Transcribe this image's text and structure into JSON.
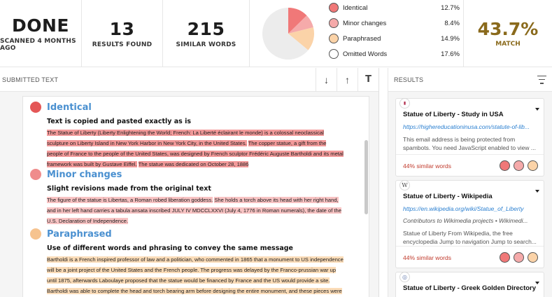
{
  "stats": {
    "status": {
      "value": "DONE",
      "label": "SCANNED 4 MONTHS AGO"
    },
    "results": {
      "value": "13",
      "label": "RESULTS FOUND"
    },
    "words": {
      "value": "215",
      "label": "SIMILAR WORDS"
    }
  },
  "pie": {
    "segments": [
      {
        "name": "Identical",
        "percent": 12.7,
        "color": "#f07878"
      },
      {
        "name": "Minor changes",
        "percent": 8.4,
        "color": "#f5aaaa"
      },
      {
        "name": "Paraphrased",
        "percent": 14.9,
        "color": "#fbd3a8"
      },
      {
        "name": "Remaining",
        "percent": 64.0,
        "color": "#ececec"
      }
    ]
  },
  "legend": [
    {
      "label": "Identical",
      "value": "12.7%",
      "color": "#f07878"
    },
    {
      "label": "Minor changes",
      "value": "8.4%",
      "color": "#f5aaaa"
    },
    {
      "label": "Paraphrased",
      "value": "14.9%",
      "color": "#fbd3a8"
    },
    {
      "label": "Omitted Words",
      "value": "17.6%",
      "color": "#ffffff"
    }
  ],
  "match": {
    "value": "43.7%",
    "label": "MATCH"
  },
  "submitted": {
    "title": "SUBMITTED TEXT",
    "tools": {
      "down": "↓",
      "up": "↑",
      "text": "T"
    },
    "sections": [
      {
        "title": "Identical",
        "color": "#e45757",
        "subtitle": "Text is copied and pasted exactly as is",
        "parts": [
          {
            "text": "The Statue of Liberty (Liberty Enlightening the World; French: La Liberté éclairant le monde) is a colossal neoclassical sculpture on Liberty Island in New York Harbor in New York City, in the United States.",
            "hl": "red"
          },
          {
            "text": " ",
            "hl": ""
          },
          {
            "text": "The copper statue, a gift from the people of France to the people of the United States, was designed by French sculptor Frédéric Auguste Bartholdi and its metal framework was built by Gustave Eiffel.",
            "hl": "red"
          },
          {
            "text": " ",
            "hl": ""
          },
          {
            "text": "The statue was dedicated on October 28, 1886",
            "hl": "red"
          }
        ]
      },
      {
        "title": "Minor changes",
        "color": "#ef8c8c",
        "subtitle": "Slight revisions made from the original text",
        "parts": [
          {
            "text": "The figure of the statue is Libertas, a Roman robed liberation goddess.",
            "hl": "pink"
          },
          {
            "text": " ",
            "hl": ""
          },
          {
            "text": "She holds a torch above its head with her right hand, and in her left hand carries a tabula ansata inscribed JULY IV MDCCLXXVI (July 4, 1776 in Roman numerals), the date of the U.S. Declaration of Independence.",
            "hl": "pink"
          }
        ]
      },
      {
        "title": "Paraphrased",
        "color": "#f6c38f",
        "subtitle": "Use of different words and phrasing to convey the same message",
        "parts": [
          {
            "text": "Bartholdi is a French inspired professor of law and a politician, who commented in 1865 that a monument to US independence will be a joint project of the United States and the French people. The progress was delayed by the Franco-prussian war up until 1875, afterwards Laboulaye proposed that the statue would be financed by France and the US would provide a site. Bartholdi was able to complete the head and torch bearing arm before designing the entire monument, and these pieces were shown at international expositions for publicity.",
            "hl": "peach"
          }
        ]
      }
    ]
  },
  "results": {
    "title": "RESULTS",
    "cards": [
      {
        "favicon": "▮",
        "title": "Statue of Liberty - Study in USA",
        "url": "https://highereducationinusa.com/statute-of-lib...",
        "meta": "",
        "snippet": "This email address is being protected from spambots. You need JavaScript enabled to view ...",
        "similar": "44% similar words"
      },
      {
        "favicon": "W",
        "title": "Statue of Liberty - Wikipedia",
        "url": "https://en.wikipedia.org/wiki/Statue_of_Liberty",
        "meta": "Contributors to Wikimedia projects  •  Wikimedi...",
        "snippet": "Statue of Liberty From Wikipedia, the free encyclopedia Jump to navigation Jump to search...",
        "similar": "44% similar words"
      },
      {
        "favicon": "◎",
        "title": "Statue of Liberty - Greek Golden Directory",
        "url": "",
        "meta": "",
        "snippet": "",
        "similar": ""
      }
    ]
  }
}
